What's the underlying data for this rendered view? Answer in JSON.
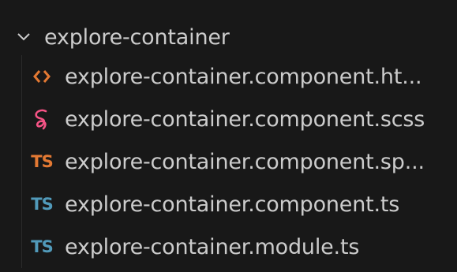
{
  "explorer": {
    "folder": {
      "name": "explore-container",
      "expanded": true,
      "chevron_icon": "chevron-down-icon"
    },
    "files": [
      {
        "name": "explore-container.component.ht...",
        "icon": "html-icon",
        "icon_glyph": "",
        "icon_color": "#e37933"
      },
      {
        "name": "explore-container.component.scss",
        "icon": "sass-icon",
        "icon_glyph": "",
        "icon_color": "#f55385"
      },
      {
        "name": "explore-container.component.sp...",
        "icon": "ts-spec-icon",
        "icon_glyph": "TS",
        "icon_color": "#e37933"
      },
      {
        "name": "explore-container.component.ts",
        "icon": "typescript-icon",
        "icon_glyph": "TS",
        "icon_color": "#519aba"
      },
      {
        "name": "explore-container.module.ts",
        "icon": "typescript-icon",
        "icon_glyph": "TS",
        "icon_color": "#519aba"
      }
    ]
  },
  "colors": {
    "background": "#181818",
    "text": "#cccccc"
  }
}
